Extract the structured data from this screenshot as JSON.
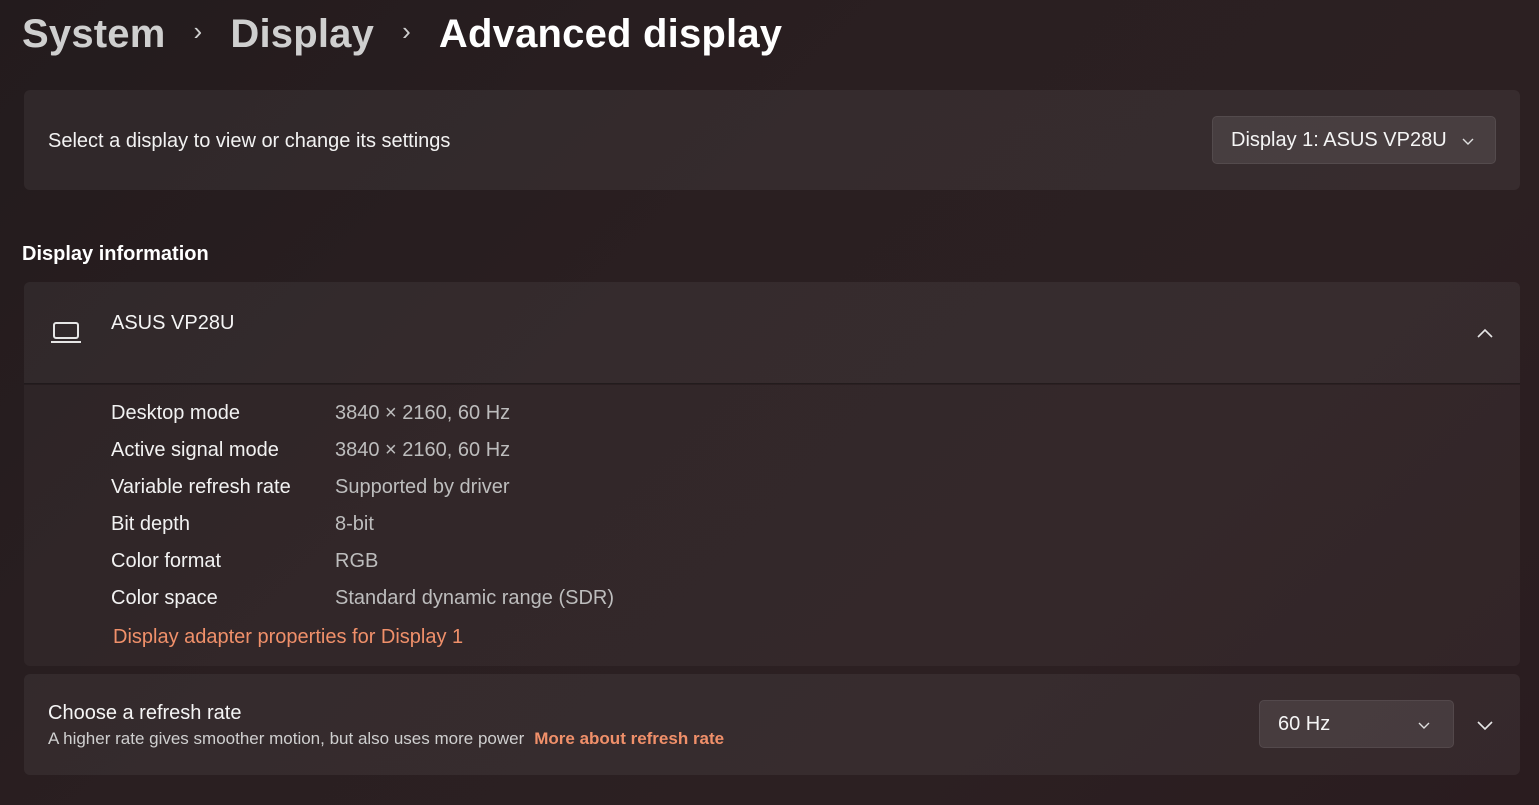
{
  "breadcrumb": {
    "items": [
      "System",
      "Display",
      "Advanced display"
    ],
    "separator": "›"
  },
  "select_display": {
    "label": "Select a display to view or change its settings",
    "selected": "Display 1: ASUS VP28U",
    "chevron_icon": "chevron-down-icon"
  },
  "display_information": {
    "title": "Display information",
    "monitor_name": "ASUS VP28U",
    "monitor_icon": "laptop-icon",
    "collapse_icon": "chevron-up-icon",
    "rows": [
      {
        "key": "Desktop mode",
        "value": "3840 × 2160, 60 Hz"
      },
      {
        "key": "Active signal mode",
        "value": "3840 × 2160, 60 Hz"
      },
      {
        "key": "Variable refresh rate",
        "value": "Supported by driver"
      },
      {
        "key": "Bit depth",
        "value": "8-bit"
      },
      {
        "key": "Color format",
        "value": "RGB"
      },
      {
        "key": "Color space",
        "value": "Standard dynamic range (SDR)"
      }
    ],
    "adapter_link": "Display adapter properties for Display 1"
  },
  "refresh_rate": {
    "title": "Choose a refresh rate",
    "description": "A higher rate gives smoother motion, but also uses more power",
    "more_link": "More about refresh rate",
    "selected": "60 Hz",
    "expand_icon": "chevron-down-icon"
  },
  "colors": {
    "accent_link": "#f0906a",
    "background": "#261d1f"
  }
}
